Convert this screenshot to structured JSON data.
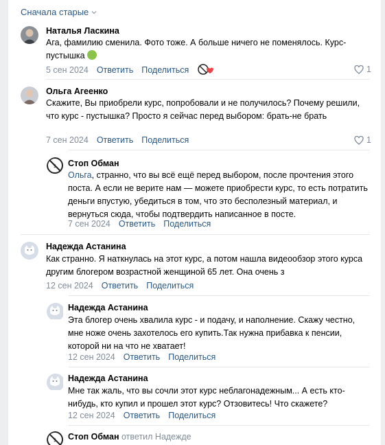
{
  "sort": {
    "label": "Сначала старые"
  },
  "comments": [
    {
      "author": "Наталья Ласкина",
      "text": "Ага, фамилию сменила. Фото тоже. А больше ничего не поменялось. Курс-пустышка",
      "date": "5 сен 2024",
      "reply": "Ответить",
      "share": "Поделиться",
      "likes": "1"
    },
    {
      "author": "Ольга Агеенко",
      "text": "Скажите, Вы приобрели курс, попробовали и не получилось? Почему решили, что курс - пустышка? Просто я сейчас перед выбором: брать-не брать",
      "date": "7 сен 2024",
      "reply": "Ответить",
      "share": "Поделиться",
      "likes": "1"
    },
    {
      "author": "Стоп Обман",
      "mention": "Ольга",
      "text": ", странно, что вы всё ещё перед выбором, после прочтения этого поста. А если не верите нам — можете приобрести курс, то есть потратить деньги впустую, убедиться в том, что это бесполезный материал, и вернуться сюда, чтобы подтвердить написанное в посте.",
      "date": "7 сен 2024",
      "reply": "Ответить",
      "share": "Поделиться"
    },
    {
      "author": "Надежда Астанина",
      "text": "Как странно. Я наткнулась на этот курс, а потом нашла видеообзор этого курса другим блогером возрастной женщиной 65 лет. Она очень з",
      "date": "12 сен 2024",
      "reply": "Ответить",
      "share": "Поделиться"
    },
    {
      "author": "Надежда Астанина",
      "text": "Эта блогер очень хвалила курс - и подачу, и наполнение. Скажу честно, мне ноже очень захотелось его купить.Так нужна прибавка к пенсии, которой ни на что не хватает!",
      "date": "12 сен 2024",
      "reply": "Ответить",
      "share": "Поделиться"
    },
    {
      "author": "Надежда Астанина",
      "text": "Мне так жаль, что вы сочли этот курс неблагонадежным... А есть кто-нибудь, кто купил и прошел этот курс? Отзовитесь! Что скажете?",
      "date": "12 сен 2024",
      "reply": "Ответить",
      "share": "Поделиться"
    },
    {
      "author": "Стоп Обман",
      "replied_to": "ответил Надежде"
    }
  ]
}
